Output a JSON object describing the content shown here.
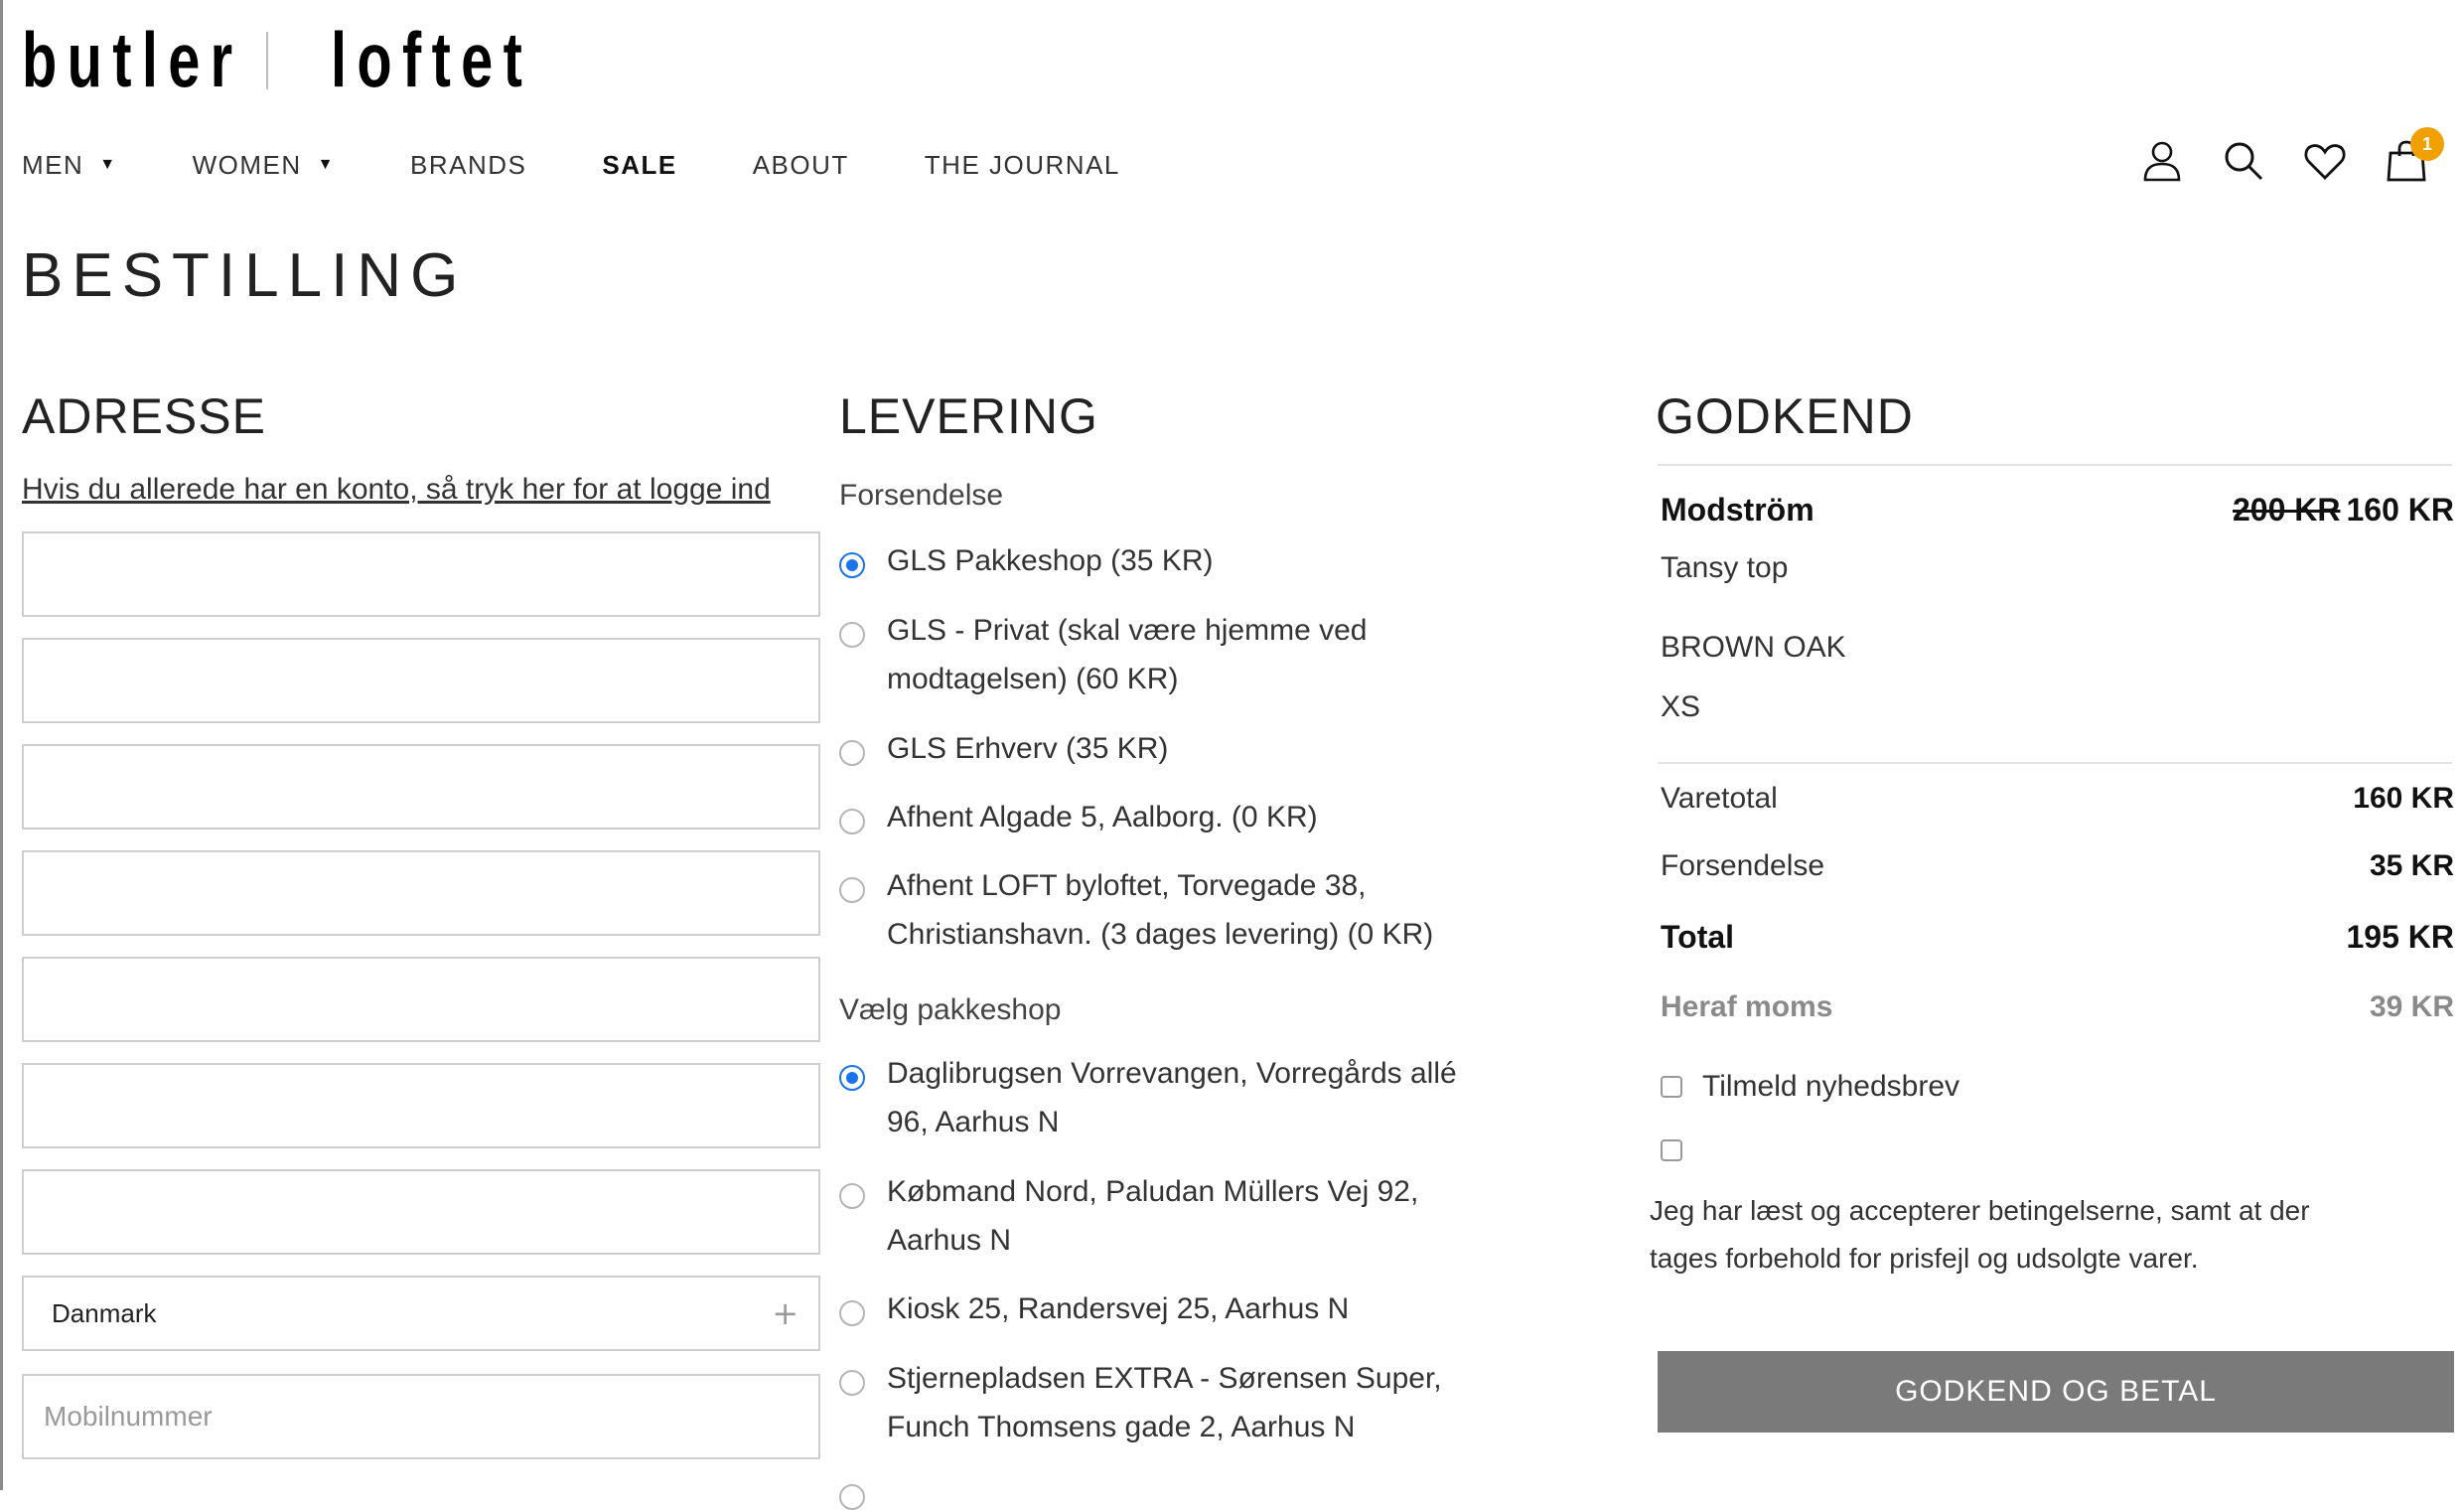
{
  "brand": {
    "word1": "butler",
    "word2": "loftet"
  },
  "nav": {
    "items": [
      {
        "label": "MEN",
        "dropdown": true
      },
      {
        "label": "WOMEN",
        "dropdown": true
      },
      {
        "label": "BRANDS",
        "dropdown": false
      },
      {
        "label": "SALE",
        "dropdown": false,
        "bold": true
      },
      {
        "label": "ABOUT",
        "dropdown": false
      },
      {
        "label": "THE JOURNAL",
        "dropdown": false
      }
    ],
    "caret": "▼"
  },
  "header_icons": {
    "account": "user-icon",
    "search": "search-icon",
    "wishlist": "heart-icon",
    "cart": "shopping-bag-icon",
    "cart_count": "1",
    "badge_color": "#f0a000"
  },
  "page_title": "BESTILLING",
  "address": {
    "heading": "ADRESSE",
    "login_link": "Hvis du allerede har en konto, så tryk her for at logge ind",
    "country_value": "Danmark",
    "phone_placeholder": "Mobilnummer"
  },
  "delivery": {
    "heading": "LEVERING",
    "shipping_label": "Forsendelse",
    "shipping_options": [
      {
        "label": "GLS Pakkeshop (35 KR)",
        "selected": true
      },
      {
        "label": "GLS - Privat (skal være hjemme ved modtagelsen) (60 KR)",
        "selected": false
      },
      {
        "label": "GLS Erhverv (35 KR)",
        "selected": false
      },
      {
        "label": "Afhent Algade 5, Aalborg. (0 KR)",
        "selected": false
      },
      {
        "label": "Afhent LOFT byloftet, Torvegade 38, Christianshavn. (3 dages levering) (0 KR)",
        "selected": false
      }
    ],
    "pakkeshop_label": "Vælg pakkeshop",
    "pakkeshop_options": [
      {
        "label": "Daglibrugsen Vorrevangen, Vorregårds allé 96, Aarhus N",
        "selected": true
      },
      {
        "label": "Købmand Nord, Paludan Müllers Vej 92, Aarhus N",
        "selected": false
      },
      {
        "label": "Kiosk 25, Randersvej 25, Aarhus N",
        "selected": false
      },
      {
        "label": "Stjernepladsen EXTRA - Sørensen Super, Funch Thomsens gade 2, Aarhus N",
        "selected": false
      }
    ],
    "accent_color": "#1a73e8"
  },
  "approve": {
    "heading": "GODKEND",
    "product": {
      "brand": "Modström",
      "old_price": "200 KR",
      "price": "160 KR",
      "name": "Tansy top",
      "color": "BROWN OAK",
      "size": "XS"
    },
    "totals": {
      "subtotal_label": "Varetotal",
      "subtotal": "160 KR",
      "shipping_label": "Forsendelse",
      "shipping": "35 KR",
      "total_label": "Total",
      "total": "195 KR",
      "vat_label": "Heraf moms",
      "vat": "39 KR"
    },
    "newsletter_label": "Tilmeld nyhedsbrev",
    "terms_text": "Jeg har læst og accepterer betingelserne, samt at der tages forbehold for prisfejl og udsolgte varer.",
    "pay_button": "GODKEND OG BETAL",
    "button_color": "#7a7a7a"
  }
}
